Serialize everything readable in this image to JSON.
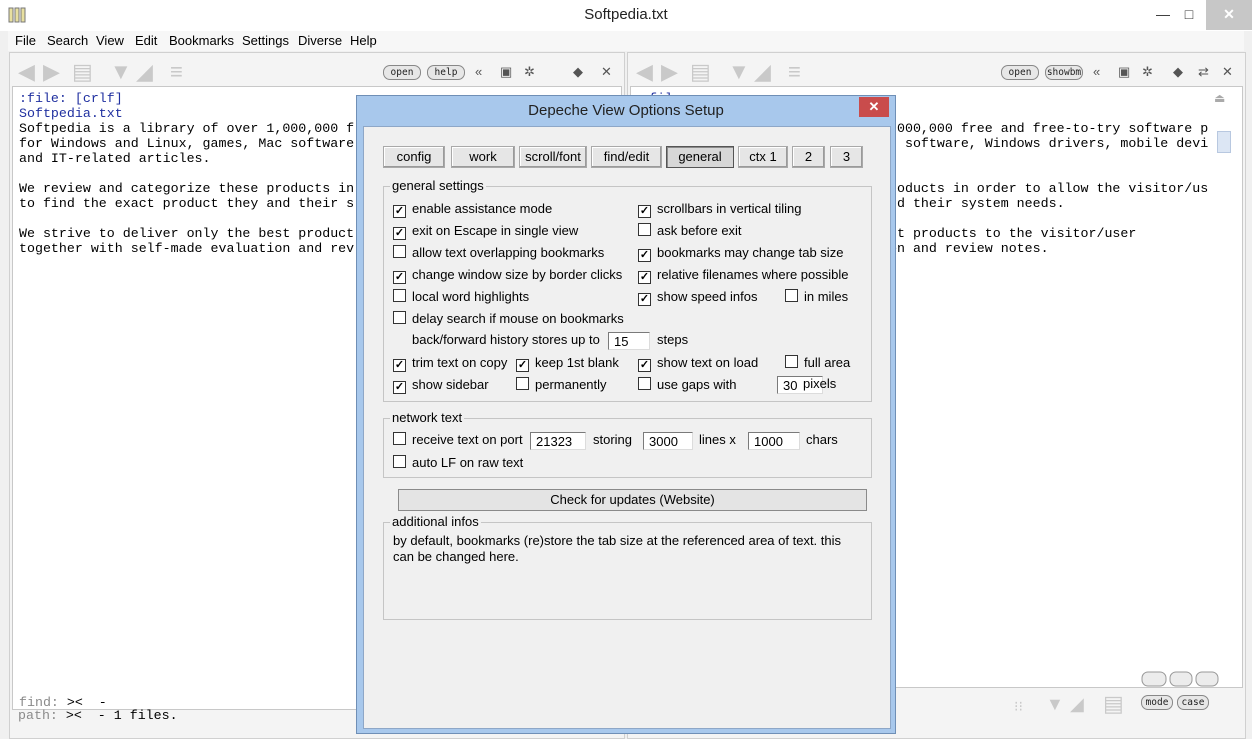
{
  "window": {
    "title": "Softpedia.txt",
    "minimize": "—",
    "maximize": "□",
    "close": "✕"
  },
  "menu": [
    "File",
    "Search",
    "View",
    "Edit",
    "Bookmarks",
    "Settings",
    "Diverse",
    "Help"
  ],
  "left_pane": {
    "buttons": {
      "open": "open",
      "help": "help"
    },
    "lines": [
      ":file: [crlf]",
      "Softpedia.txt",
      "Softpedia is a library of over 1,000,000 f",
      "for Windows and Linux, games, Mac software",
      "and IT-related articles.",
      "",
      "We review and categorize these products in",
      "to find the exact product they and their s",
      "",
      "We strive to deliver only the best product",
      "together with self-made evaluation and rev"
    ],
    "find_line": "find: >< -",
    "find_prefix": "find:",
    "find_value": "><  -",
    "path_prefix": "path:",
    "path_value": "><  - 1 files."
  },
  "right_pane": {
    "buttons": {
      "open": "open",
      "showbm": "showbm",
      "mode": "mode",
      "case": "case"
    },
    "lines": [
      ":file:",
      "",
      ",000,000 free and free-to-try software p",
      "c software, Windows drivers, mobile devi",
      "",
      "",
      "roducts in order to allow the visitor/us",
      "nd their system needs.",
      "",
      "st products to the visitor/user",
      "on and review notes."
    ]
  },
  "dialog": {
    "title": "Depeche View Options Setup",
    "tabs": [
      "config",
      "work",
      "scroll/font",
      "find/edit",
      "general",
      "ctx 1",
      "2",
      "3"
    ],
    "active_tab": "general",
    "general_settings": {
      "label": "general settings",
      "options": {
        "enable_assistance_mode": {
          "label": "enable assistance mode",
          "checked": true
        },
        "exit_on_escape": {
          "label": "exit on Escape in single view",
          "checked": true
        },
        "allow_overlap": {
          "label": "allow text overlapping bookmarks",
          "checked": false
        },
        "change_window_size": {
          "label": "change window size by border clicks",
          "checked": true
        },
        "local_word_highlights": {
          "label": "local word highlights",
          "checked": false
        },
        "delay_search": {
          "label": "delay search if mouse on bookmarks",
          "checked": false
        },
        "trim_text": {
          "label": "trim text on copy",
          "checked": true
        },
        "keep_blank": {
          "label": "keep 1st blank",
          "checked": true
        },
        "show_sidebar": {
          "label": "show sidebar",
          "checked": true
        },
        "permanently": {
          "label": "permanently",
          "checked": false
        },
        "scrollbars_vertical": {
          "label": "scrollbars in vertical tiling",
          "checked": true
        },
        "ask_before_exit": {
          "label": "ask before exit",
          "checked": false
        },
        "bookmarks_change_tab": {
          "label": "bookmarks may change tab size",
          "checked": true
        },
        "relative_filenames": {
          "label": "relative filenames where possible",
          "checked": true
        },
        "show_speed_infos": {
          "label": "show speed infos",
          "checked": true
        },
        "in_miles": {
          "label": "in miles",
          "checked": false
        },
        "show_text_on_load": {
          "label": "show text on load",
          "checked": true
        },
        "full_area": {
          "label": "full area",
          "checked": false
        },
        "use_gaps": {
          "label": "use gaps with",
          "checked": false
        }
      },
      "history_label": "back/forward history stores up to",
      "history_value": "15",
      "history_unit": "steps",
      "gaps_value": "30",
      "gaps_unit": "pixels"
    },
    "network_text": {
      "label": "network text",
      "receive": {
        "label": "receive text on port",
        "checked": false
      },
      "port": "21323",
      "storing_label": "storing",
      "lines_value": "3000",
      "lines_label": "lines x",
      "chars_value": "1000",
      "chars_label": "chars",
      "auto_lf": {
        "label": "auto LF on raw text",
        "checked": false
      }
    },
    "update_button": "Check for updates (Website)",
    "additional_infos": {
      "label": "additional infos",
      "text": "by default, bookmarks (re)store the tab size at the referenced area of text. this can be changed here."
    }
  }
}
